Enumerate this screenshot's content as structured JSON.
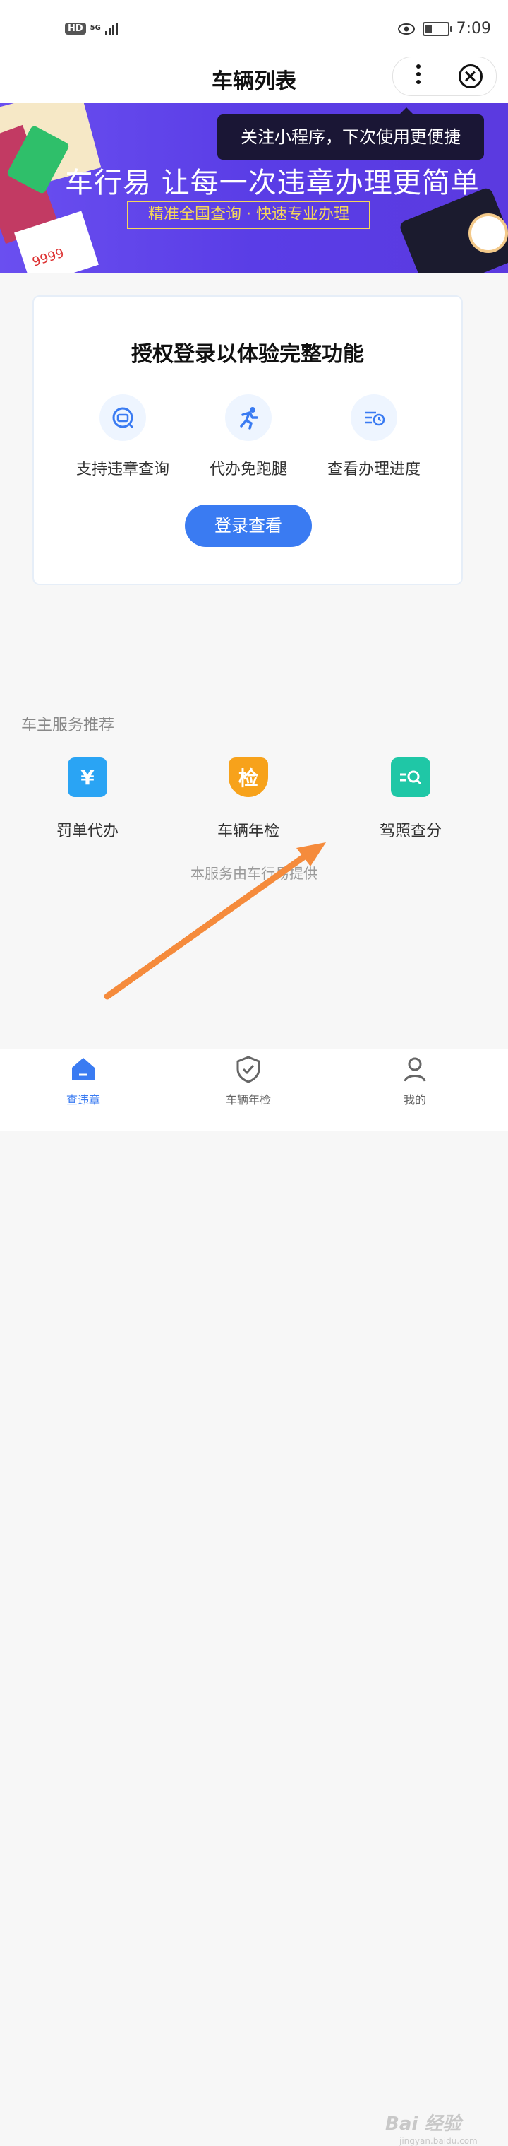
{
  "status_bar": {
    "hd": "HD",
    "network": "5G",
    "time": "7:09"
  },
  "header": {
    "title": "车辆列表"
  },
  "banner": {
    "headline": "车行易 让每一次违章办理更简单",
    "subline": "精准全国查询 · 快速专业办理",
    "ticket_text": "9999",
    "colors": {
      "background": "#5b3ae0",
      "accent": "#f5d65a"
    }
  },
  "tooltip": {
    "text": "关注小程序，下次使用更便捷"
  },
  "auth_card": {
    "title": "授权登录以体验完整功能",
    "features": [
      {
        "icon": "car-search-icon",
        "label": "支持违章查询"
      },
      {
        "icon": "running-man-icon",
        "label": "代办免跑腿"
      },
      {
        "icon": "progress-clock-icon",
        "label": "查看办理进度"
      }
    ],
    "login_button": "登录查看"
  },
  "services": {
    "title": "车主服务推荐",
    "items": [
      {
        "icon": "yuan-icon",
        "label": "罚单代办",
        "color": "#2aa4f4"
      },
      {
        "icon": "inspection-shield-icon",
        "glyph": "检",
        "label": "车辆年检",
        "color": "#f7a21b"
      },
      {
        "icon": "license-search-icon",
        "label": "驾照查分",
        "color": "#1fc7a6"
      }
    ],
    "provided_by": "本服务由车行易提供"
  },
  "tab_bar": {
    "tabs": [
      {
        "icon": "home-icon",
        "label": "查违章",
        "active": true
      },
      {
        "icon": "shield-check-icon",
        "label": "车辆年检",
        "active": false
      },
      {
        "icon": "user-icon",
        "label": "我的",
        "active": false
      }
    ]
  },
  "watermark": {
    "text": "Bai 经验",
    "sub": "jingyan.baidu.com"
  },
  "accent_color": "#3a7bf2",
  "annotation_color": "#f58b3c"
}
